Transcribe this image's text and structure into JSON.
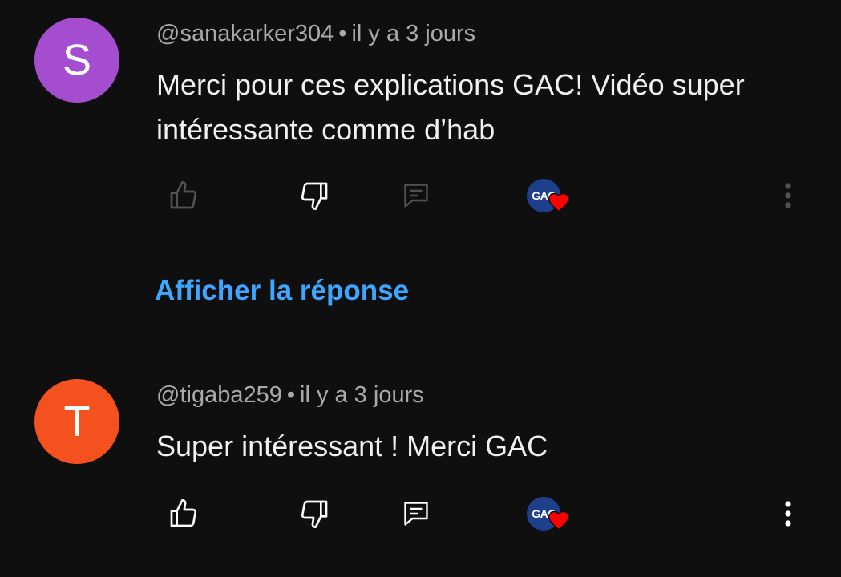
{
  "comments": [
    {
      "avatar_letter": "S",
      "avatar_color": "#a54dcf",
      "handle": "@sanakarker304",
      "separator": "•",
      "time": "il y a 3 jours",
      "text": "Merci pour ces explications GAC! Vidéo super intéressante comme d’hab",
      "creator_heart_label": "GAC",
      "icons": {
        "like": "thumbs-up-icon",
        "dislike": "thumbs-down-icon",
        "reply": "comment-icon",
        "heart": "heart-icon",
        "more": "more-vert-icon"
      }
    },
    {
      "avatar_letter": "T",
      "avatar_color": "#f4511e",
      "handle": "@tigaba259",
      "separator": "•",
      "time": "il y a 3 jours",
      "text": "Super intéressant ! Merci GAC",
      "creator_heart_label": "GAC",
      "icons": {
        "like": "thumbs-up-icon",
        "dislike": "thumbs-down-icon",
        "reply": "comment-icon",
        "heart": "heart-icon",
        "more": "more-vert-icon"
      }
    }
  ],
  "show_reply_label": "Afficher la réponse",
  "colors": {
    "background": "#0f0f0f",
    "link": "#3ea6ff",
    "heart": "#ff0000",
    "creator_logo": "#1d3f8c"
  }
}
